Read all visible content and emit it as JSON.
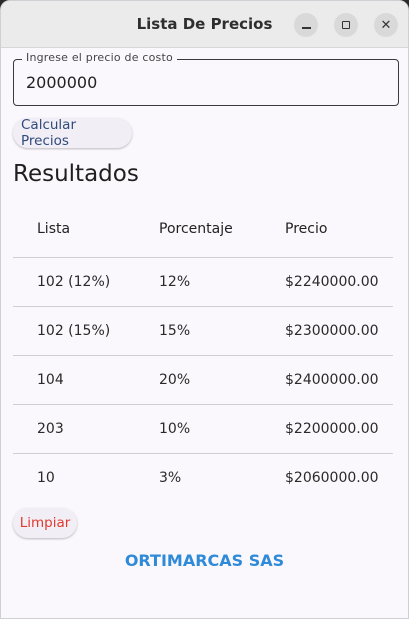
{
  "window": {
    "title": "Lista De Precios"
  },
  "form": {
    "cost_label": "Ingrese el precio de costo",
    "cost_value": "2000000",
    "calc_button": "Calcular Precios"
  },
  "results": {
    "heading": "Resultados",
    "columns": [
      "Lista",
      "Porcentaje",
      "Precio"
    ],
    "rows": [
      {
        "lista": "102 (12%)",
        "porcentaje": "12%",
        "precio": "$2240000.00"
      },
      {
        "lista": "102 (15%)",
        "porcentaje": "15%",
        "precio": "$2300000.00"
      },
      {
        "lista": "104",
        "porcentaje": "20%",
        "precio": "$2400000.00"
      },
      {
        "lista": "203",
        "porcentaje": "10%",
        "precio": "$2200000.00"
      },
      {
        "lista": "10",
        "porcentaje": "3%",
        "precio": "$2060000.00"
      }
    ]
  },
  "actions": {
    "clear_button": "Limpiar"
  },
  "footer": {
    "brand": "ORTIMARCAS SAS"
  },
  "colors": {
    "accent": "#2f4a7c",
    "danger": "#e03b2f",
    "brand": "#2f8ad8"
  }
}
